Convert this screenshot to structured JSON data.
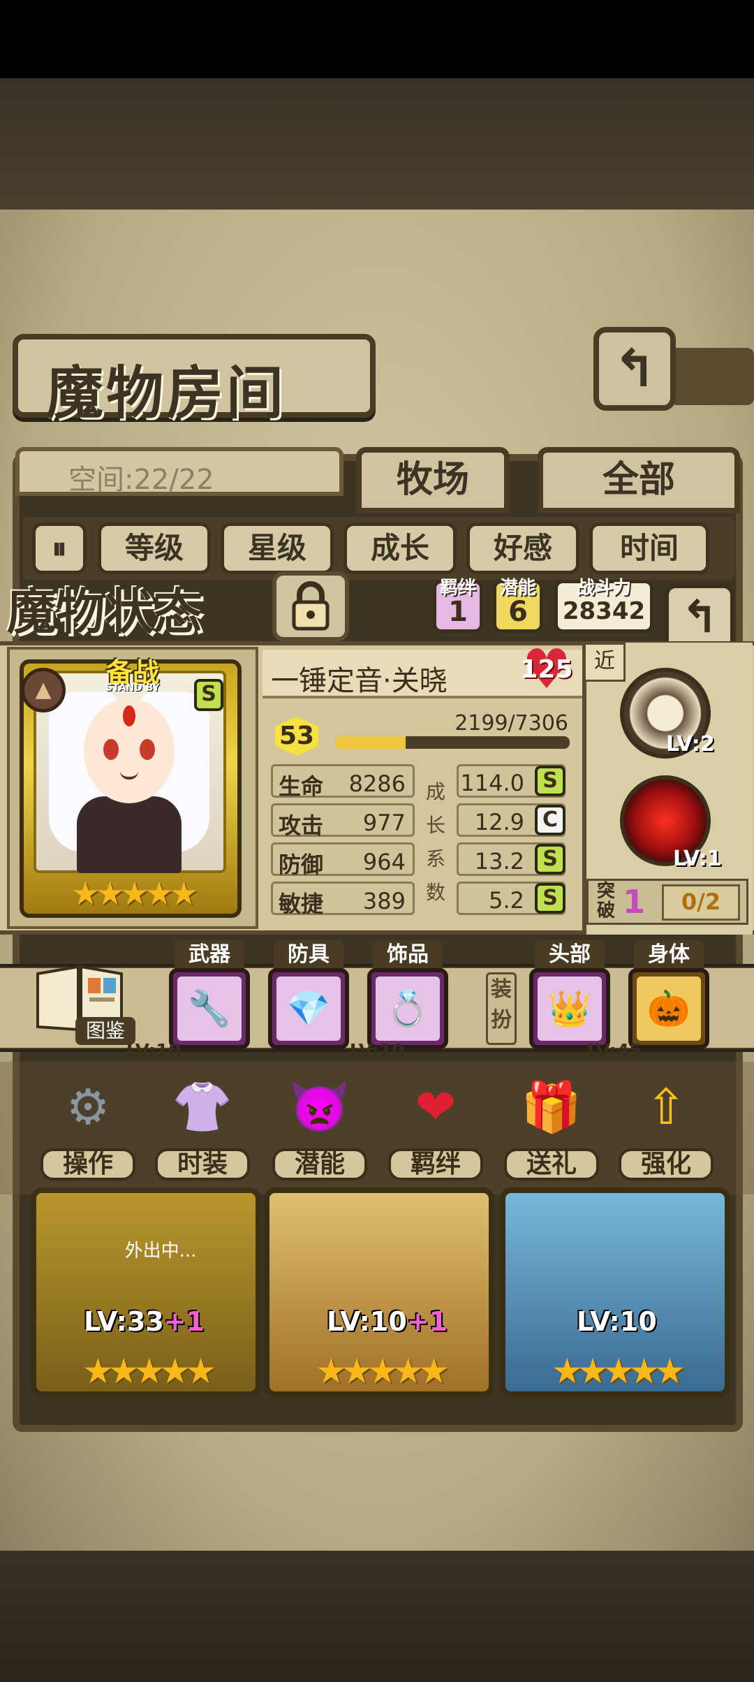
{
  "header": {
    "title": "魔物房间",
    "back_icon": "return-arrow-icon",
    "capacity": "空间:22/22",
    "tabs": [
      "牧场",
      "全部"
    ]
  },
  "sort": {
    "toggle_icon": "sort-toggle-icon",
    "buttons": [
      "等级",
      "星级",
      "成长",
      "好感",
      "时间"
    ]
  },
  "status": {
    "title": "魔物状态",
    "bond_label": "羁绊",
    "bond_value": "1",
    "potential_label": "潜能",
    "potential_value": "6",
    "power_label": "战斗力",
    "power_value": "28342",
    "return_icon": "return-arrow-icon"
  },
  "monster": {
    "standby": "备战",
    "standby_sub": "STAND BY",
    "rank": "S",
    "stars": "★★★★★",
    "name": "一锤定音·关晓",
    "affection": "125",
    "level": "53",
    "xp": "2199/7306",
    "xp_fraction": 0.301,
    "stats": [
      {
        "label": "生命",
        "value": "8286",
        "growth": "114.0",
        "grade": "S"
      },
      {
        "label": "攻击",
        "value": "977",
        "growth": "12.9",
        "grade": "C"
      },
      {
        "label": "防御",
        "value": "964",
        "growth": "13.2",
        "grade": "S"
      },
      {
        "label": "敏捷",
        "value": "389",
        "growth": "5.2",
        "grade": "S"
      }
    ],
    "growth_label": "成长系数",
    "range": "近",
    "skills": [
      {
        "level": "LV:2"
      },
      {
        "level": "LV:1"
      }
    ],
    "break_label": "突破",
    "break_value": "1",
    "break_progress": "0/2"
  },
  "equipment": {
    "codex": "图鉴",
    "slots": [
      "武器",
      "防具",
      "饰品",
      "头部",
      "身体"
    ],
    "dress_label": "装扮"
  },
  "actions": [
    "操作",
    "时装",
    "潜能",
    "羁绊",
    "送礼",
    "强化"
  ],
  "roster": [
    {
      "level": "LV:33",
      "bonus": "+1",
      "stars": "★★★★★",
      "status": "外出中..."
    },
    {
      "level": "LV:10",
      "bonus": "+1",
      "stars": "★★★★★"
    },
    {
      "level": "LV:10",
      "stars": "★★★★★"
    }
  ],
  "roster_partial": [
    "LV:10",
    "LV:10",
    "LV:45"
  ],
  "colors": {
    "accent": "#f0c840",
    "grade_s": "#c0e050",
    "heart": "#d82838",
    "break": "#c848c0"
  }
}
